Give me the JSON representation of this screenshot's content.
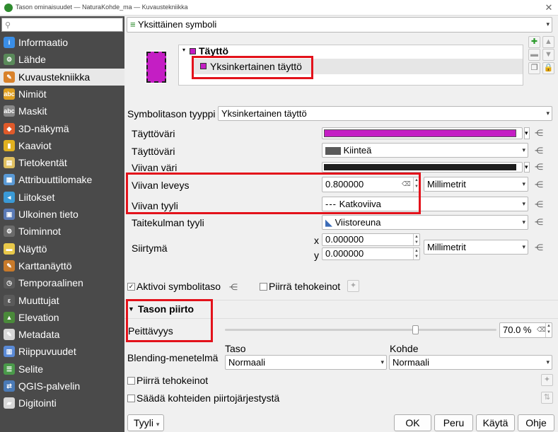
{
  "window": {
    "title": "Tason ominaisuudet — NaturaKohde_ma — Kuvaustekniikka"
  },
  "search": {
    "placeholder": ""
  },
  "sidebar": {
    "items": [
      {
        "label": "Informaatio",
        "icon": "info-icon",
        "color": "#3a8ee6",
        "glyph": "i"
      },
      {
        "label": "Lähde",
        "icon": "source-icon",
        "color": "#5a8a5a",
        "glyph": "⚙"
      },
      {
        "label": "Kuvaustekniikka",
        "icon": "paintbrush-icon",
        "color": "#d9822b",
        "glyph": "✎"
      },
      {
        "label": "Nimiöt",
        "icon": "labels-icon",
        "color": "#e0a020",
        "glyph": "abc"
      },
      {
        "label": "Maskit",
        "icon": "masks-icon",
        "color": "#888888",
        "glyph": "abc"
      },
      {
        "label": "3D-näkymä",
        "icon": "3d-cube-icon",
        "color": "#e05a2a",
        "glyph": "◆"
      },
      {
        "label": "Kaaviot",
        "icon": "diagrams-icon",
        "color": "#e0b020",
        "glyph": "▮"
      },
      {
        "label": "Tietokentät",
        "icon": "fields-icon",
        "color": "#e0c060",
        "glyph": "▤"
      },
      {
        "label": "Attribuuttilomake",
        "icon": "form-icon",
        "color": "#5a9ad6",
        "glyph": "▦"
      },
      {
        "label": "Liitokset",
        "icon": "joins-icon",
        "color": "#3a9ad6",
        "glyph": "◂"
      },
      {
        "label": "Ulkoinen tieto",
        "icon": "auxiliary-storage-icon",
        "color": "#5a7ab6",
        "glyph": "▣"
      },
      {
        "label": "Toiminnot",
        "icon": "actions-icon",
        "color": "#6a6a6a",
        "glyph": "⚙"
      },
      {
        "label": "Näyttö",
        "icon": "display-icon",
        "color": "#e8c84a",
        "glyph": "▬"
      },
      {
        "label": "Karttanäyttö",
        "icon": "rendering-icon",
        "color": "#c87a2a",
        "glyph": "✎"
      },
      {
        "label": "Temporaalinen",
        "icon": "clock-icon",
        "color": "#5a5a5a",
        "glyph": "◷"
      },
      {
        "label": "Muuttujat",
        "icon": "variables-icon",
        "color": "#5a5a5a",
        "glyph": "ε"
      },
      {
        "label": "Elevation",
        "icon": "elevation-icon",
        "color": "#4a8a3a",
        "glyph": "▲"
      },
      {
        "label": "Metadata",
        "icon": "metadata-icon",
        "color": "#d8d8d8",
        "glyph": "✎"
      },
      {
        "label": "Riippuvuudet",
        "icon": "dependencies-icon",
        "color": "#5a8ad6",
        "glyph": "▥"
      },
      {
        "label": "Selite",
        "icon": "legend-icon",
        "color": "#4a9a4a",
        "glyph": "☰"
      },
      {
        "label": "QGIS-palvelin",
        "icon": "server-icon",
        "color": "#4a7ab6",
        "glyph": "⇄"
      },
      {
        "label": "Digitointi",
        "icon": "digitizing-icon",
        "color": "#d8d8d8",
        "glyph": "▰"
      }
    ]
  },
  "renderer": {
    "type": "Yksittäinen symboli"
  },
  "symbol_tree": {
    "fill": "Täyttö",
    "simple_fill": "Yksinkertainen täyttö",
    "preview_color": "#c41ec4"
  },
  "symbol_layer": {
    "type_label": "Symbolitason tyyppi",
    "type_value": "Yksinkertainen täyttö",
    "fill_color_label": "Täyttöväri",
    "fill_color": "#c41ec4",
    "fill_style_label": "Täyttöväri",
    "fill_style": "Kiinteä",
    "stroke_color_label": "Viivan väri",
    "stroke_color": "#1e1e1e",
    "stroke_width_label": "Viivan leveys",
    "stroke_width": "0.800000",
    "stroke_width_unit": "Millimetrit",
    "stroke_style_label": "Viivan tyyli",
    "stroke_style": "Katkoviiva",
    "join_style_label": "Taitekulman tyyli",
    "join_style": "Viistoreuna",
    "offset_label": "Siirtymä",
    "offset_x_label": "x",
    "offset_x": "0.000000",
    "offset_y_label": "y",
    "offset_y": "0.000000",
    "offset_unit": "Millimetrit"
  },
  "options": {
    "enable_layer": "Aktivoi symbolitaso",
    "draw_effects": "Piirrä tehokeinot"
  },
  "layer_rendering": {
    "header": "Tason piirto",
    "opacity_label": "Peittävyys",
    "opacity_value": "70.0 %",
    "opacity_fraction": 0.7,
    "blending_label": "Blending-menetelmä",
    "layer_label": "Taso",
    "layer_value": "Normaali",
    "feature_label": "Kohde",
    "feature_value": "Normaali",
    "draw_effects": "Piirrä tehokeinot",
    "control_order": "Säädä kohteiden piirtojärjestystä"
  },
  "buttons": {
    "style": "Tyyli",
    "ok": "OK",
    "cancel": "Peru",
    "apply": "Käytä",
    "help": "Ohje"
  }
}
